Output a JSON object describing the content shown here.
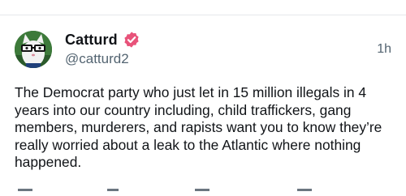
{
  "post": {
    "author": {
      "display_name": "Catturd",
      "handle": "@catturd2",
      "verified": true,
      "verified_color": "#e8537a"
    },
    "timestamp": "1h",
    "text": "The Democrat party who just let in 15 million illegals in 4 years into our country including, child traffickers, gang members, murderers, and rapists want you to know they’re really worried about a leak to the Atlantic where nothing happened."
  },
  "icons": {
    "verified": "verified-badge-icon",
    "actions": [
      "reply-icon",
      "repost-icon",
      "like-icon",
      "share-icon"
    ]
  }
}
